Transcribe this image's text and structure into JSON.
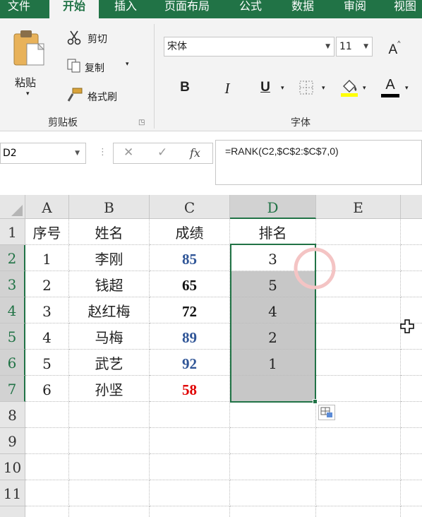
{
  "tabs": [
    "文件",
    "开始",
    "插入",
    "页面布局",
    "公式",
    "数据",
    "审阅",
    "视图"
  ],
  "active_tab": "开始",
  "clipboard": {
    "paste_label": "粘贴",
    "cut_label": "剪切",
    "copy_label": "复制",
    "format_painter_label": "格式刷",
    "group_label": "剪贴板"
  },
  "font": {
    "font_name": "宋体",
    "font_size": "11",
    "bold_label": "B",
    "italic_label": "I",
    "underline_label": "U",
    "font_color_label": "A",
    "grow_label": "A",
    "group_label": "字体"
  },
  "formula_bar": {
    "name_box": "D2",
    "formula": "=RANK(C2,$C$2:$C$7,0)",
    "cancel_symbol": "✕",
    "enter_symbol": "✓",
    "fx_label": "fx"
  },
  "columns": [
    "A",
    "B",
    "C",
    "D",
    "E"
  ],
  "row_numbers": [
    "1",
    "2",
    "3",
    "4",
    "5",
    "6",
    "7",
    "8",
    "9",
    "10",
    "11"
  ],
  "headers": [
    "序号",
    "姓名",
    "成绩",
    "排名"
  ],
  "rows": [
    {
      "no": "1",
      "name": "李刚",
      "score": "85",
      "rank": "3"
    },
    {
      "no": "2",
      "name": "钱超",
      "score": "65",
      "rank": "5"
    },
    {
      "no": "3",
      "name": "赵红梅",
      "score": "72",
      "rank": "4"
    },
    {
      "no": "4",
      "name": "马梅",
      "score": "89",
      "rank": "2"
    },
    {
      "no": "5",
      "name": "武艺",
      "score": "92",
      "rank": "1"
    },
    {
      "no": "6",
      "name": "孙坚",
      "score": "58",
      "rank": ""
    }
  ],
  "colors": {
    "accent": "#217346",
    "score_blue": "#2f5597",
    "score_black": "#111111",
    "score_red": "#e00000",
    "selection_fill": "#c7c7c7"
  }
}
